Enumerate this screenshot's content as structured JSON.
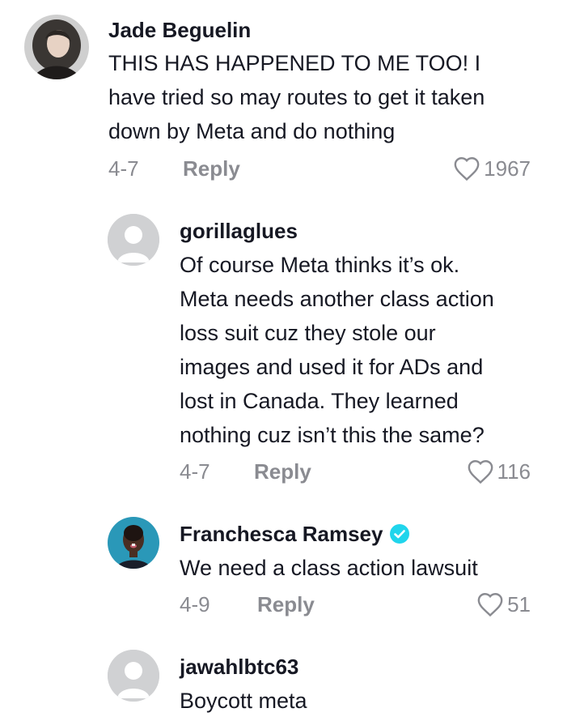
{
  "comments": [
    {
      "username": "Jade Beguelin",
      "text_lines": [
        "THIS HAS HAPPENED TO ME TOO! I",
        "have tried so may routes to get it taken",
        "down by Meta and do nothing"
      ],
      "date": "4-7",
      "reply_label": "Reply",
      "likes": "1967",
      "avatar": "photo-avatar"
    },
    {
      "username": "gorillaglues",
      "text_lines": [
        "Of course Meta thinks it’s ok.",
        "Meta needs another class action",
        "loss suit cuz they stole our",
        "images and used it for ADs and",
        "lost in Canada. They learned",
        "nothing cuz isn’t this the same?"
      ],
      "date": "4-7",
      "reply_label": "Reply",
      "likes": "116",
      "avatar": "default-avatar"
    },
    {
      "username": "Franchesca Ramsey",
      "verified": true,
      "text_lines": [
        "We need a class action lawsuit"
      ],
      "date": "4-9",
      "reply_label": "Reply",
      "likes": "51",
      "avatar": "photo-avatar"
    },
    {
      "username": "jawahlbtc63",
      "text_lines": [
        "Boycott meta"
      ],
      "avatar": "default-avatar"
    }
  ],
  "colors": {
    "text": "#161823",
    "muted": "#8a8b91",
    "verified": "#20d5ec",
    "default_avatar_bg": "#d0d1d3"
  }
}
